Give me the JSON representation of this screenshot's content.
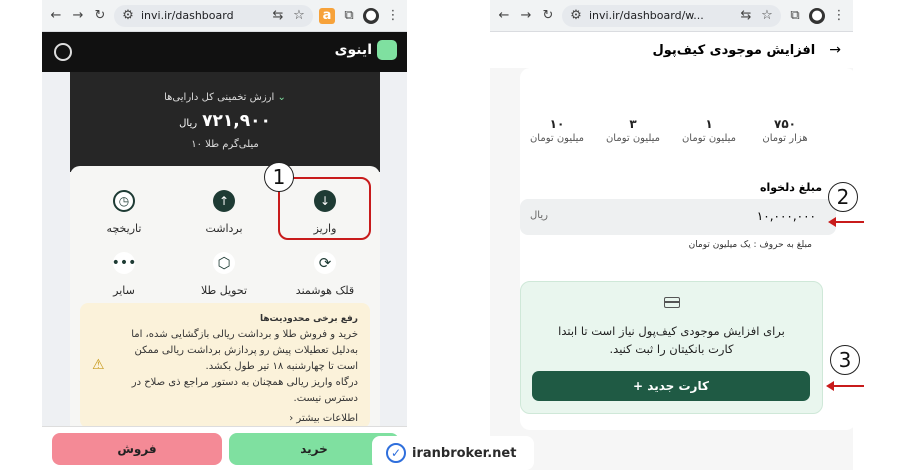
{
  "left_browser": {
    "url": "invi.ir/dashboard"
  },
  "left_app": {
    "logo": "اینوی",
    "asset_label": "ارزش تخمینی کل دارایی‌ها",
    "asset_value": "۷۲۱,۹۰۰",
    "asset_unit": "ریال",
    "gold": "۱۰ میلی‌گرم طلا",
    "actions": [
      {
        "label": "واریز"
      },
      {
        "label": "برداشت"
      },
      {
        "label": "تاریخچه"
      },
      {
        "label": "قلک هوشمند"
      },
      {
        "label": "تحویل طلا"
      },
      {
        "label": "سایر"
      }
    ],
    "notice": {
      "title": "رفع برخی محدودیت‌ها",
      "body1": "خرید و فروش طلا و برداشت ریالی بازگشایی شده، اما به‌دلیل تعطیلات پیش رو پردازش برداشت ریالی ممکن است تا چهارشنبه ۱۸ تیر طول بکشد.",
      "body2": "درگاه واریز ریالی همچنان به دستور مراجع ذی صلاح در دسترس نیست.",
      "more": "اطلاعات بیشتر"
    },
    "buy": "خرید",
    "sell": "فروش"
  },
  "right_browser": {
    "url": "invi.ir/dashboard/w..."
  },
  "right_app": {
    "title": "افزایش موجودی کیف‌پول",
    "presets": [
      {
        "value": "۷۵۰",
        "unit": "هزار تومان"
      },
      {
        "value": "۱",
        "unit": "میلیون تومان"
      },
      {
        "value": "۳",
        "unit": "میلیون تومان"
      },
      {
        "value": "۱۰",
        "unit": "میلیون تومان"
      }
    ],
    "amount_label": "مبلغ دلخواه",
    "amount_value": "۱۰,۰۰۰,۰۰۰",
    "amount_unit": "ریال",
    "amount_words": "مبلغ به حروف : یک میلیون تومان",
    "card_msg": "برای افزایش موجودی کیف‌پول نیاز است تا ابتدا کارت بانکیتان را ثبت کنید.",
    "new_card": "+ کارت جدید"
  },
  "annotations": {
    "n1": "1",
    "n2": "2",
    "n3": "3",
    "watermark": "iranbroker.net"
  },
  "colors": {
    "accent": "#1f5a44",
    "annotation_red": "#c81b1b",
    "buy": "#7fe0a0",
    "sell": "#f48a96"
  }
}
